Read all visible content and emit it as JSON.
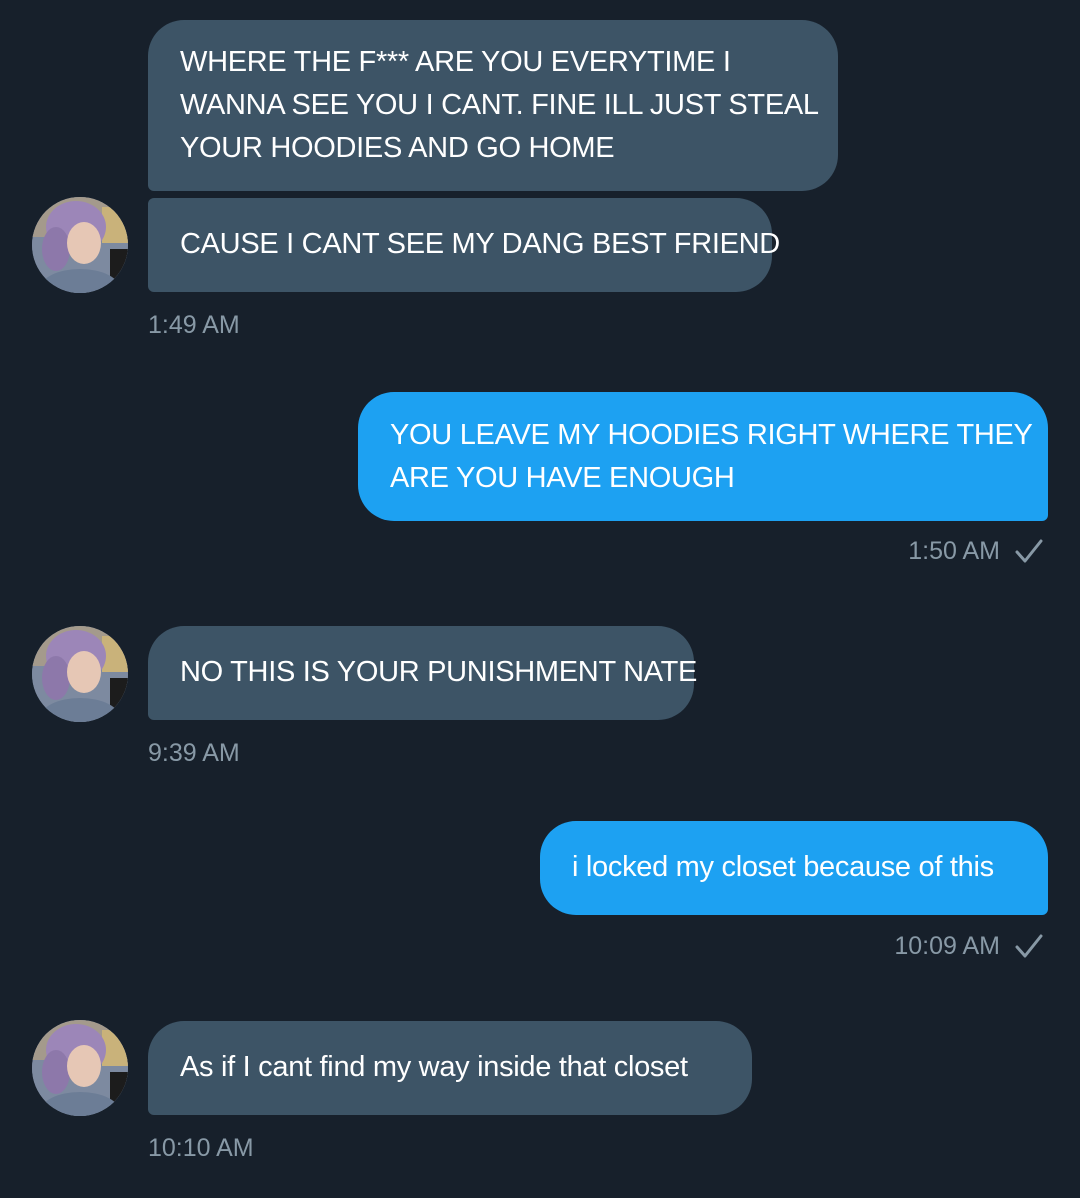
{
  "conversation": [
    {
      "kind": "incoming",
      "bubbles": [
        {
          "lines": [
            "WHERE THE F*** ARE YOU EVERYTIME I",
            "WANNA SEE YOU I CANT. FINE ILL JUST STEAL",
            "YOUR HOODIES AND GO HOME"
          ]
        },
        {
          "lines": [
            "CAUSE I CANT SEE MY DANG BEST FRIEND"
          ]
        }
      ],
      "time": "1:49 AM"
    },
    {
      "kind": "outgoing",
      "bubbles": [
        {
          "lines": [
            "YOU LEAVE MY HOODIES RIGHT WHERE THEY",
            "ARE YOU HAVE ENOUGH"
          ]
        }
      ],
      "time": "1:50 AM",
      "status_icon": "checkmark-icon"
    },
    {
      "kind": "incoming",
      "bubbles": [
        {
          "lines": [
            "NO THIS IS YOUR PUNISHMENT NATE"
          ]
        }
      ],
      "time": "9:39 AM"
    },
    {
      "kind": "outgoing",
      "bubbles": [
        {
          "lines": [
            "i locked my closet because of this"
          ]
        }
      ],
      "time": "10:09 AM",
      "status_icon": "checkmark-icon"
    },
    {
      "kind": "incoming",
      "bubbles": [
        {
          "lines": [
            "As if I cant find my way inside that closet"
          ]
        }
      ],
      "time": "10:10 AM"
    }
  ],
  "colors": {
    "background": "#17202b",
    "incoming_bubble": "#3d5466",
    "outgoing_bubble": "#1da1f2",
    "timestamp": "#8899a6",
    "text": "#ffffff"
  }
}
